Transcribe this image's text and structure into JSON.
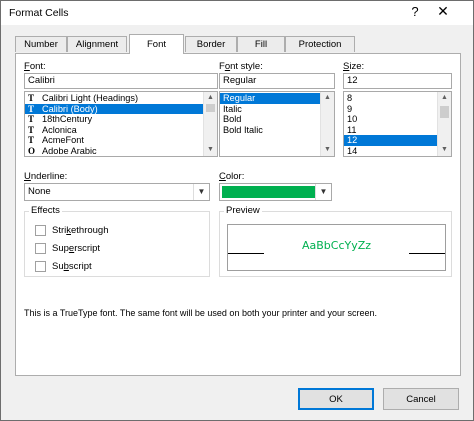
{
  "window": {
    "title": "Format Cells",
    "help_glyph": "?",
    "close_glyph": "✕"
  },
  "tabs": [
    "Number",
    "Alignment",
    "Font",
    "Border",
    "Fill",
    "Protection"
  ],
  "active_tab": "Font",
  "font": {
    "label_pre": "",
    "label_u": "F",
    "label_post": "ont:",
    "value": "Calibri",
    "items": [
      {
        "name": "Calibri Light (Headings)",
        "icon": "truetype-icon",
        "selected": false
      },
      {
        "name": "Calibri (Body)",
        "icon": "truetype-icon",
        "selected": true
      },
      {
        "name": "18thCentury",
        "icon": "truetype-icon",
        "selected": false
      },
      {
        "name": "Aclonica",
        "icon": "truetype-icon",
        "selected": false
      },
      {
        "name": "AcmeFont",
        "icon": "truetype-icon",
        "selected": false
      },
      {
        "name": "Adobe Arabic",
        "icon": "opentype-icon",
        "selected": false
      }
    ]
  },
  "font_style": {
    "label_pre": "F",
    "label_u": "o",
    "label_post": "nt style:",
    "value": "Regular",
    "items": [
      {
        "name": "Regular",
        "selected": true
      },
      {
        "name": "Italic",
        "selected": false
      },
      {
        "name": "Bold",
        "selected": false
      },
      {
        "name": "Bold Italic",
        "selected": false
      }
    ]
  },
  "size": {
    "label_pre": "",
    "label_u": "S",
    "label_post": "ize:",
    "value": "12",
    "items": [
      {
        "name": "8",
        "selected": false
      },
      {
        "name": "9",
        "selected": false
      },
      {
        "name": "10",
        "selected": false
      },
      {
        "name": "11",
        "selected": false
      },
      {
        "name": "12",
        "selected": true
      },
      {
        "name": "14",
        "selected": false
      }
    ]
  },
  "underline": {
    "label_pre": "",
    "label_u": "U",
    "label_post": "nderline:",
    "value": "None"
  },
  "color": {
    "label_pre": "",
    "label_u": "C",
    "label_post": "olor:",
    "swatch": "#00b050"
  },
  "effects": {
    "title": "Effects",
    "items": [
      {
        "pre": "Stri",
        "u": "k",
        "post": "ethrough",
        "checked": false
      },
      {
        "pre": "Sup",
        "u": "e",
        "post": "rscript",
        "checked": false
      },
      {
        "pre": "Su",
        "u": "b",
        "post": "script",
        "checked": false
      }
    ]
  },
  "preview": {
    "title": "Preview",
    "sample": "AaBbCcYyZz",
    "sample_color": "#00b050"
  },
  "info_text": "This is a TrueType font.  The same font will be used on both your printer and your screen.",
  "buttons": {
    "ok": "OK",
    "cancel": "Cancel"
  },
  "colors": {
    "accent": "#0078d7",
    "dialog_bg": "#f0f0f0"
  }
}
